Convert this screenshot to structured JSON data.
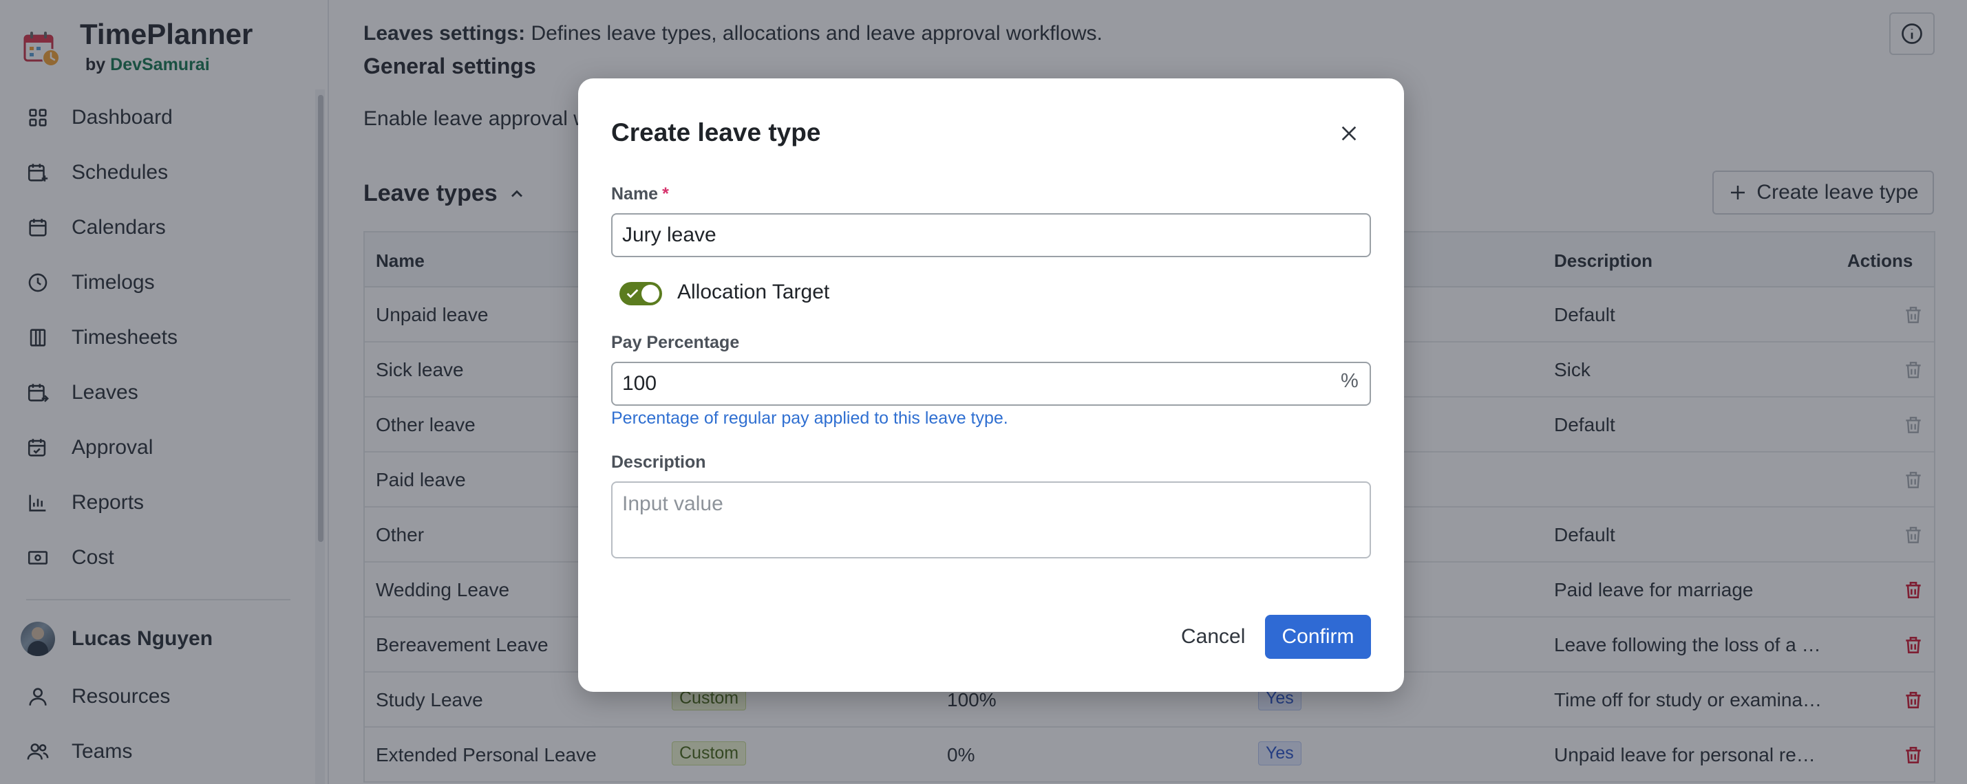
{
  "brand": {
    "name": "TimePlanner",
    "by": "by",
    "org": "DevSamurai"
  },
  "nav": [
    {
      "label": "Dashboard",
      "icon": "dashboard-icon"
    },
    {
      "label": "Schedules",
      "icon": "schedules-icon"
    },
    {
      "label": "Calendars",
      "icon": "calendar-icon"
    },
    {
      "label": "Timelogs",
      "icon": "clock-icon"
    },
    {
      "label": "Timesheets",
      "icon": "timesheets-icon"
    },
    {
      "label": "Leaves",
      "icon": "leaves-icon"
    },
    {
      "label": "Approval",
      "icon": "approval-icon"
    },
    {
      "label": "Reports",
      "icon": "reports-icon"
    },
    {
      "label": "Cost",
      "icon": "cost-icon"
    }
  ],
  "user": {
    "name": "Lucas Nguyen"
  },
  "nav2": [
    {
      "label": "Resources",
      "icon": "user-icon"
    },
    {
      "label": "Teams",
      "icon": "teams-icon"
    }
  ],
  "header": {
    "title": "Leaves settings:",
    "subtitle": "Defines leave types, allocations and leave approval workflows."
  },
  "general": {
    "title": "General settings",
    "enable_text": "Enable leave approval workflow"
  },
  "leave_types": {
    "title": "Leave types",
    "create_button": "Create leave type",
    "columns": {
      "name": "Name",
      "description": "Description",
      "actions": "Actions"
    },
    "rows": [
      {
        "name": "Unpaid leave",
        "type": "",
        "pay": "",
        "alloc": "",
        "description": "Default",
        "deletable": false
      },
      {
        "name": "Sick leave",
        "type": "",
        "pay": "",
        "alloc": "",
        "description": "Sick",
        "deletable": false
      },
      {
        "name": "Other leave",
        "type": "",
        "pay": "",
        "alloc": "",
        "description": "Default",
        "deletable": false
      },
      {
        "name": "Paid leave",
        "type": "",
        "pay": "",
        "alloc": "",
        "description": "",
        "deletable": false
      },
      {
        "name": "Other",
        "type": "",
        "pay": "",
        "alloc": "",
        "description": "Default",
        "deletable": false
      },
      {
        "name": "Wedding Leave",
        "type": "",
        "pay": "",
        "alloc": "",
        "description": "Paid leave for marriage",
        "deletable": true
      },
      {
        "name": "Bereavement Leave",
        "type": "",
        "pay": "",
        "alloc": "",
        "description": "Leave following the loss of a family member",
        "deletable": true
      },
      {
        "name": "Study Leave",
        "type": "Custom",
        "pay": "100%",
        "alloc": "Yes",
        "description": "Time off for study or examinations",
        "deletable": true
      },
      {
        "name": "Extended Personal Leave",
        "type": "Custom",
        "pay": "0%",
        "alloc": "Yes",
        "description": "Unpaid leave for personal reasons",
        "deletable": true
      }
    ]
  },
  "modal": {
    "title": "Create leave type",
    "name_label": "Name",
    "required_mark": "*",
    "name_value": "Jury leave",
    "allocation_label": "Allocation Target",
    "allocation_on": true,
    "pay_label": "Pay Percentage",
    "pay_value": "100",
    "pay_suffix": "%",
    "pay_hint": "Percentage of regular pay applied to this leave type.",
    "description_label": "Description",
    "description_placeholder": "Input value",
    "cancel_label": "Cancel",
    "confirm_label": "Confirm"
  },
  "colors": {
    "brand_green": "#1b7a55",
    "toggle_on": "#5b7c1f",
    "primary": "#2f6ad4",
    "danger": "#d0203a",
    "hint": "#2f6fd1"
  }
}
